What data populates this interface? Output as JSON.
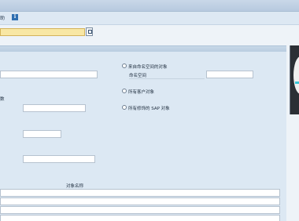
{
  "toolbar": {
    "partial_label": "助",
    "info_icon_glyph": "i"
  },
  "options": {
    "radio_namespace": "来自命名空间的对象",
    "namespace_label": "命名空间",
    "radio_customer": "所有客户对象",
    "radio_sap": "所有修饰的 SAP 对象"
  },
  "left_fragment": "数",
  "table": {
    "column_object_name": "对象名称"
  },
  "colors": {
    "command_field": "#f8e7a4",
    "panel": "#dce8f3",
    "accent": "#38c5d7"
  }
}
